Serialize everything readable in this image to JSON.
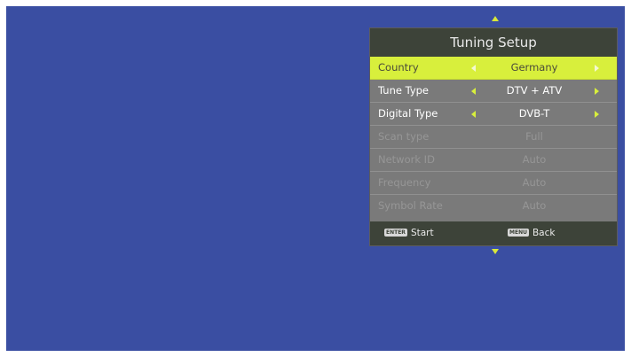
{
  "panel": {
    "title": "Tuning Setup"
  },
  "menu": {
    "items": [
      {
        "label": "Country",
        "value": "Germany"
      },
      {
        "label": "Tune Type",
        "value": "DTV + ATV"
      },
      {
        "label": "Digital Type",
        "value": "DVB-T"
      },
      {
        "label": "Scan type",
        "value": "Full"
      },
      {
        "label": "Network ID",
        "value": "Auto"
      },
      {
        "label": "Frequency",
        "value": "Auto"
      },
      {
        "label": "Symbol Rate",
        "value": "Auto"
      }
    ]
  },
  "footer": {
    "enter_key": "ENTER",
    "enter_label": "Start",
    "menu_key": "MENU",
    "menu_label": "Back"
  },
  "colors": {
    "background": "#3a4ea2",
    "highlight": "#d8ef3c",
    "panel": "#7a7a7a",
    "header": "#3d4339"
  }
}
